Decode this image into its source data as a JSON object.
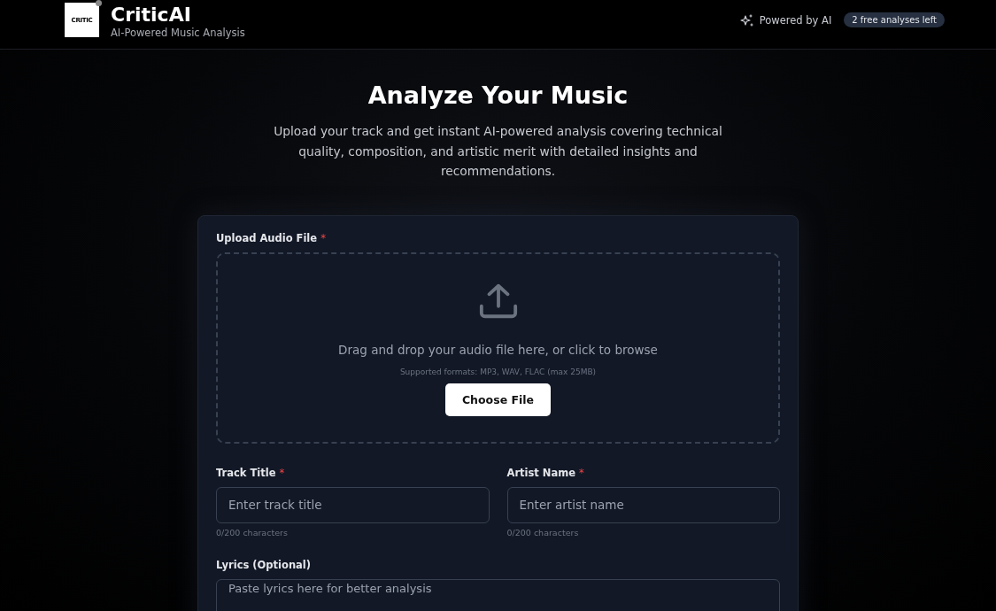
{
  "header": {
    "logo_text": "CRITIC",
    "title": "CriticAI",
    "subtitle": "AI-Powered Music Analysis",
    "powered_label": "Powered by AI",
    "credits_badge": "2 free analyses left"
  },
  "hero": {
    "heading": "Analyze Your Music",
    "description": "Upload your track and get instant AI-powered analysis covering technical quality, composition, and artistic merit with detailed insights and recommendations."
  },
  "upload": {
    "label": "Upload Audio File",
    "required_mark": "*",
    "prompt": "Drag and drop your audio file here, or click to browse",
    "formats": "Supported formats: MP3, WAV, FLAC (max 25MB)",
    "button": "Choose File"
  },
  "fields": [
    {
      "label": "Track Title",
      "required_mark": "*",
      "placeholder": "Enter track title",
      "counter": "0/200 characters"
    },
    {
      "label": "Artist Name",
      "required_mark": "*",
      "placeholder": "Enter artist name",
      "counter": "0/200 characters"
    }
  ],
  "lyrics": {
    "label": "Lyrics (Optional)",
    "placeholder": "Paste lyrics here for better analysis"
  }
}
